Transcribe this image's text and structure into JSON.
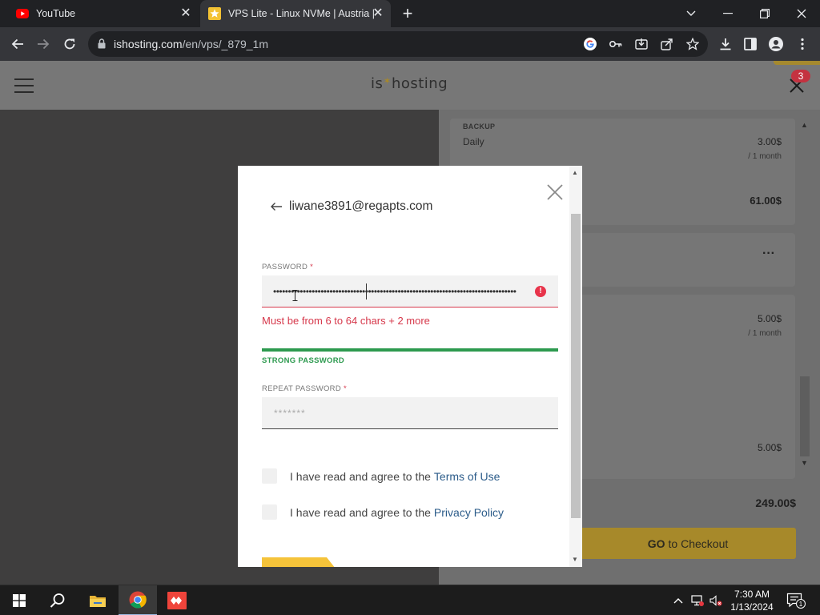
{
  "browser": {
    "tabs": [
      {
        "title": "YouTube",
        "active": false
      },
      {
        "title": "VPS Lite - Linux NVMe | Austria |",
        "active": true
      }
    ],
    "url_host": "ishosting.com",
    "url_path": "/en/vps/_879_1m"
  },
  "site": {
    "logo_left": "is",
    "logo_star": "✶",
    "logo_right": "hosting",
    "cart_badge": "3"
  },
  "order_panel": {
    "backup_label": "BACKUP",
    "backup_option": "Daily",
    "backup_price": "3.00$",
    "backup_period": "/ 1 month",
    "subtotal": "61.00$",
    "more": "···",
    "addon_price": "5.00$",
    "addon_period": "/ 1 month",
    "addon2_price": "5.00$",
    "total": "249.00$",
    "checkout_go": "GO",
    "checkout_rest": "to Checkout"
  },
  "modal": {
    "email": "liwane3891@regapts.com",
    "password_label": "PASSWORD",
    "required_mark": "*",
    "password_value": "••••••••••••••••••••••••••••••••••••••••••••••••••••••••••••••••••••••••••••••••••",
    "error_icon": "!",
    "error_message": "Must be from 6 to 64 chars + 2 more",
    "strength_text": "STRONG PASSWORD",
    "repeat_label": "REPEAT PASSWORD",
    "repeat_placeholder": "*******",
    "terms_prefix": "I have read and agree to the",
    "terms_link": "Terms of Use",
    "privacy_prefix": "I have read and agree to the",
    "privacy_link": "Privacy Policy"
  },
  "taskbar": {
    "time": "7:30 AM",
    "date": "1/13/2024",
    "notification_count": "1"
  },
  "colors": {
    "accent_yellow": "#f5c33a",
    "error_red": "#d6384b",
    "strength_green": "#2d9a4f",
    "link_blue": "#2c5c8a"
  }
}
